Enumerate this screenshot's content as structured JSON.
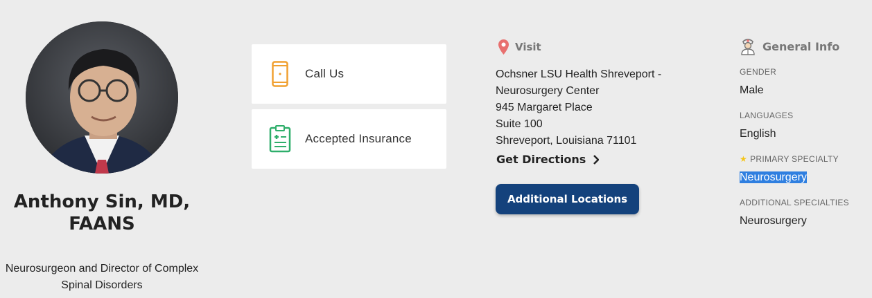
{
  "doctor": {
    "name_line1": "Anthony Sin, MD,",
    "name_line2": "FAANS",
    "title_line1": "Neurosurgeon and Director of Complex",
    "title_line2": "Spinal Disorders"
  },
  "cards": {
    "call_label": "Call Us",
    "insurance_label": "Accepted Insurance"
  },
  "visit": {
    "heading": "Visit",
    "address": [
      "Ochsner LSU Health Shreveport -",
      "Neurosurgery Center",
      "945 Margaret Place",
      "Suite 100",
      "Shreveport, Louisiana 71101"
    ],
    "directions_label": "Get Directions",
    "additional_locations_label": "Additional Locations"
  },
  "general_info": {
    "heading": "General Info",
    "gender_label": "GENDER",
    "gender_value": "Male",
    "languages_label": "LANGUAGES",
    "languages_value": "English",
    "primary_specialty_label": "PRIMARY SPECIALTY",
    "primary_specialty_value": "Neurosurgery",
    "additional_specialties_label": "ADDITIONAL SPECIALTIES",
    "additional_specialties_value": "Neurosurgery"
  },
  "icons": {
    "phone": "phone-icon",
    "insurance": "clipboard-icon",
    "visit": "map-pin-icon",
    "general_info": "doctor-icon",
    "star": "star-icon",
    "chevron": "chevron-right-icon"
  },
  "colors": {
    "background": "#ececec",
    "button": "#14427c",
    "phone_icon": "#f0a030",
    "insurance_icon": "#2eae6a",
    "pin_icon": "#e8706f",
    "star": "#f5c518",
    "highlight": "#2f7fe0"
  }
}
